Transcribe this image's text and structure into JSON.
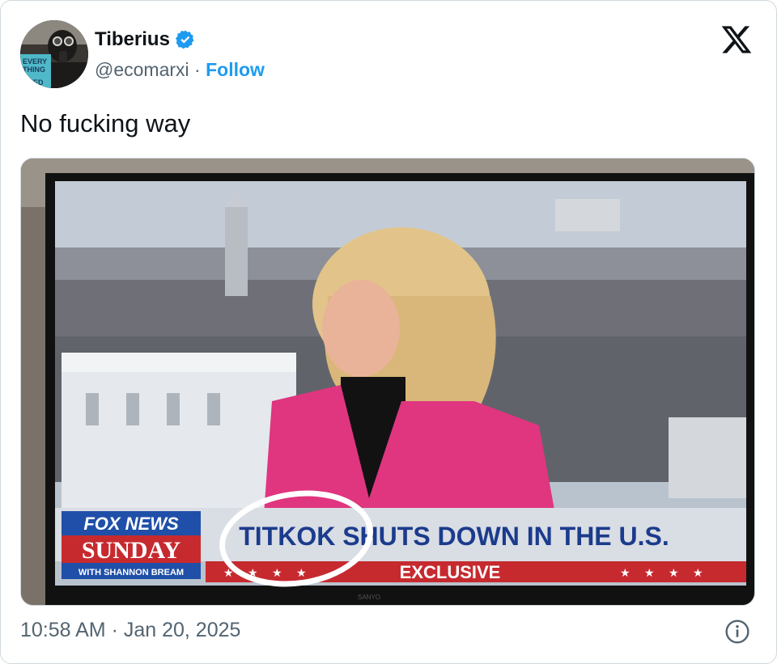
{
  "user": {
    "display_name": "Tiberius",
    "handle": "@ecomarxi",
    "separator": "·",
    "follow_label": "Follow",
    "verified_color": "#1d9bf0",
    "avatar_book_text": "EVERY\nTHING\nIS\nFUCKED"
  },
  "tweet": {
    "text": "No fucking way"
  },
  "media": {
    "chyron": {
      "network_line1": "FOX NEWS",
      "network_line2": "SUNDAY",
      "host_line": "WITH SHANNON BREAM",
      "headline": "TITKOK SHUTS DOWN IN THE U.S.",
      "exclusive": "EXCLUSIVE",
      "tv_brand": "SANYO"
    },
    "colors": {
      "jacket": "#e0357f",
      "chyron_bar": "#d9dde4",
      "chyron_red": "#c62a2f",
      "network_blue": "#1f4fa8",
      "headline_text": "#1b3b8c",
      "circle": "#ffffff"
    }
  },
  "footer": {
    "timestamp": "10:58 AM · Jan 20, 2025"
  },
  "icons": {
    "verified": "verified-badge-icon",
    "x_logo": "x-logo-icon",
    "info": "info-icon"
  }
}
